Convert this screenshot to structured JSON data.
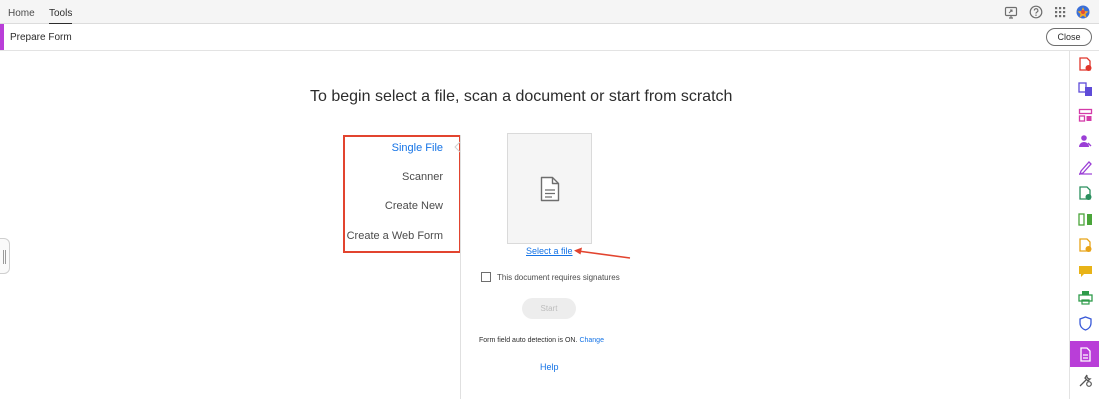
{
  "menubar": {
    "tabs": [
      {
        "label": "Home"
      },
      {
        "label": "Tools"
      }
    ],
    "icons": [
      "monitor-share-icon",
      "help-icon",
      "apps-grid-icon",
      "avatar"
    ]
  },
  "toolbar": {
    "title": "Prepare Form",
    "close_label": "Close",
    "accent_color": "#b93ed8"
  },
  "main": {
    "headline": "To begin select a file, scan a document or start from scratch",
    "options": [
      {
        "label": "Single File",
        "selected": true
      },
      {
        "label": "Scanner",
        "selected": false
      },
      {
        "label": "Create New",
        "selected": false
      },
      {
        "label": "Create a Web Form",
        "selected": false
      }
    ],
    "select_file_label": "Select a file",
    "signature_checkbox_label": "This document requires signatures",
    "signature_checked": false,
    "start_label": "Start",
    "autodetect_text": "Form field auto detection is ON.",
    "change_label": "Change",
    "help_label": "Help"
  },
  "rail": {
    "tools": [
      "export-pdf-icon",
      "combine-files-icon",
      "organize-pages-icon",
      "request-signatures-icon",
      "fill-sign-icon",
      "create-pdf-icon",
      "compare-files-icon",
      "edit-pdf-icon",
      "comment-icon",
      "print-production-icon",
      "protect-icon",
      "prepare-form-icon",
      "more-tools-icon"
    ],
    "active_tool": "prepare-form-icon"
  },
  "colors": {
    "link_blue": "#1473e6",
    "highlight_red": "#e2442f",
    "active_purple": "#b93ed8"
  }
}
